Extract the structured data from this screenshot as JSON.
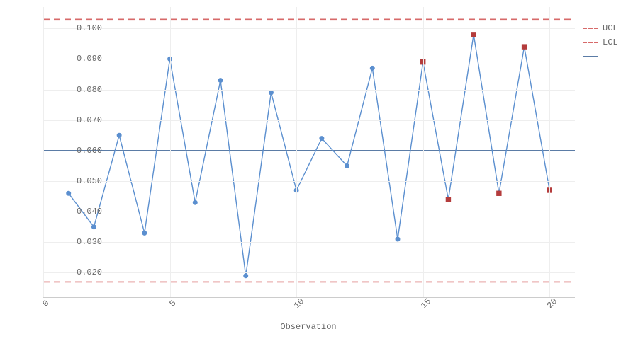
{
  "chart_data": {
    "type": "line",
    "xlabel": "Observation",
    "ylabel": "",
    "x_ticks": [
      0,
      5,
      10,
      15,
      20
    ],
    "y_ticks": [
      0.02,
      0.03,
      0.04,
      0.05,
      0.06,
      0.07,
      0.08,
      0.09,
      0.1
    ],
    "xlim": [
      0,
      21
    ],
    "ylim": [
      0.012,
      0.107
    ],
    "ucl": 0.103,
    "lcl": 0.017,
    "center": 0.06,
    "x": [
      1,
      2,
      3,
      4,
      5,
      6,
      7,
      8,
      9,
      10,
      11,
      12,
      13,
      14,
      15,
      16,
      17,
      18,
      19,
      20
    ],
    "y": [
      0.046,
      0.035,
      0.065,
      0.033,
      0.09,
      0.043,
      0.083,
      0.019,
      0.079,
      0.047,
      0.064,
      0.055,
      0.087,
      0.031,
      0.089,
      0.044,
      0.098,
      0.046,
      0.094,
      0.047
    ],
    "flagged": [
      false,
      false,
      false,
      false,
      false,
      false,
      false,
      false,
      false,
      false,
      false,
      false,
      false,
      false,
      true,
      true,
      true,
      true,
      true,
      true
    ]
  },
  "legend": {
    "ucl": "UCL",
    "lcl": "LCL",
    "cl": ""
  },
  "axis": {
    "x": "Observation"
  }
}
